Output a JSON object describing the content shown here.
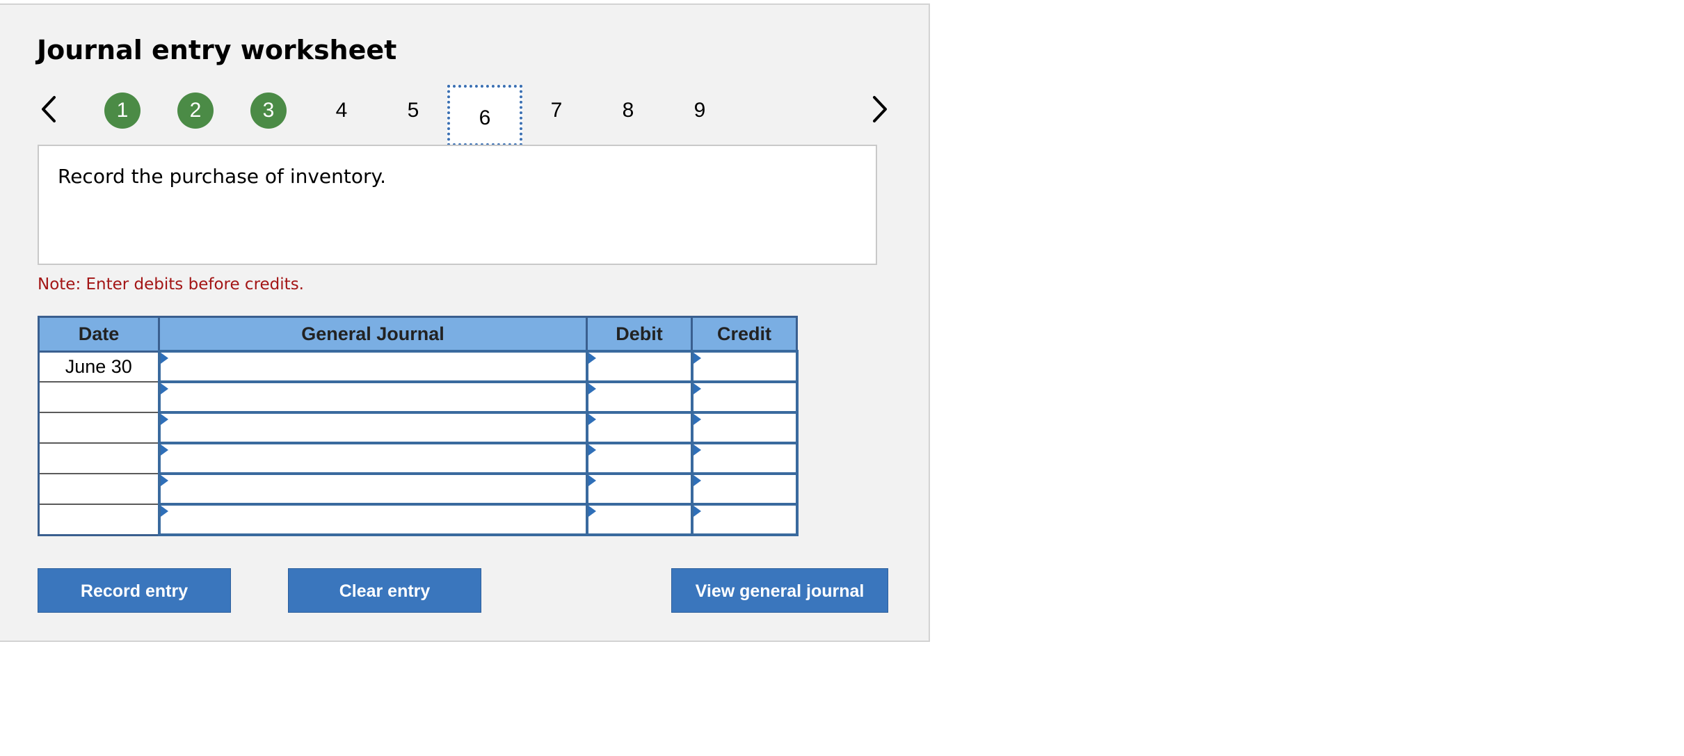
{
  "worksheet": {
    "title": "Journal entry worksheet",
    "prompt": "Record the purchase of inventory.",
    "note": "Note: Enter debits before credits."
  },
  "nav": {
    "steps": [
      {
        "label": "1",
        "state": "done"
      },
      {
        "label": "2",
        "state": "done"
      },
      {
        "label": "3",
        "state": "done"
      },
      {
        "label": "4",
        "state": "pending"
      },
      {
        "label": "5",
        "state": "pending"
      },
      {
        "label": "6",
        "state": "current"
      },
      {
        "label": "7",
        "state": "pending"
      },
      {
        "label": "8",
        "state": "pending"
      },
      {
        "label": "9",
        "state": "pending"
      }
    ],
    "prev_icon": "chevron-left-icon",
    "next_icon": "chevron-right-icon"
  },
  "table": {
    "headers": {
      "date": "Date",
      "journal": "General Journal",
      "debit": "Debit",
      "credit": "Credit"
    },
    "rows": [
      {
        "date": "June 30",
        "journal": "",
        "debit": "",
        "credit": ""
      },
      {
        "date": "",
        "journal": "",
        "debit": "",
        "credit": ""
      },
      {
        "date": "",
        "journal": "",
        "debit": "",
        "credit": ""
      },
      {
        "date": "",
        "journal": "",
        "debit": "",
        "credit": ""
      },
      {
        "date": "",
        "journal": "",
        "debit": "",
        "credit": ""
      },
      {
        "date": "",
        "journal": "",
        "debit": "",
        "credit": ""
      }
    ]
  },
  "buttons": {
    "record": "Record entry",
    "clear": "Clear entry",
    "view": "View general journal"
  },
  "colors": {
    "step_done": "#4b8b46",
    "header_bg": "#7aaee3",
    "button_bg": "#3a76bd",
    "note_text": "#a31515"
  }
}
